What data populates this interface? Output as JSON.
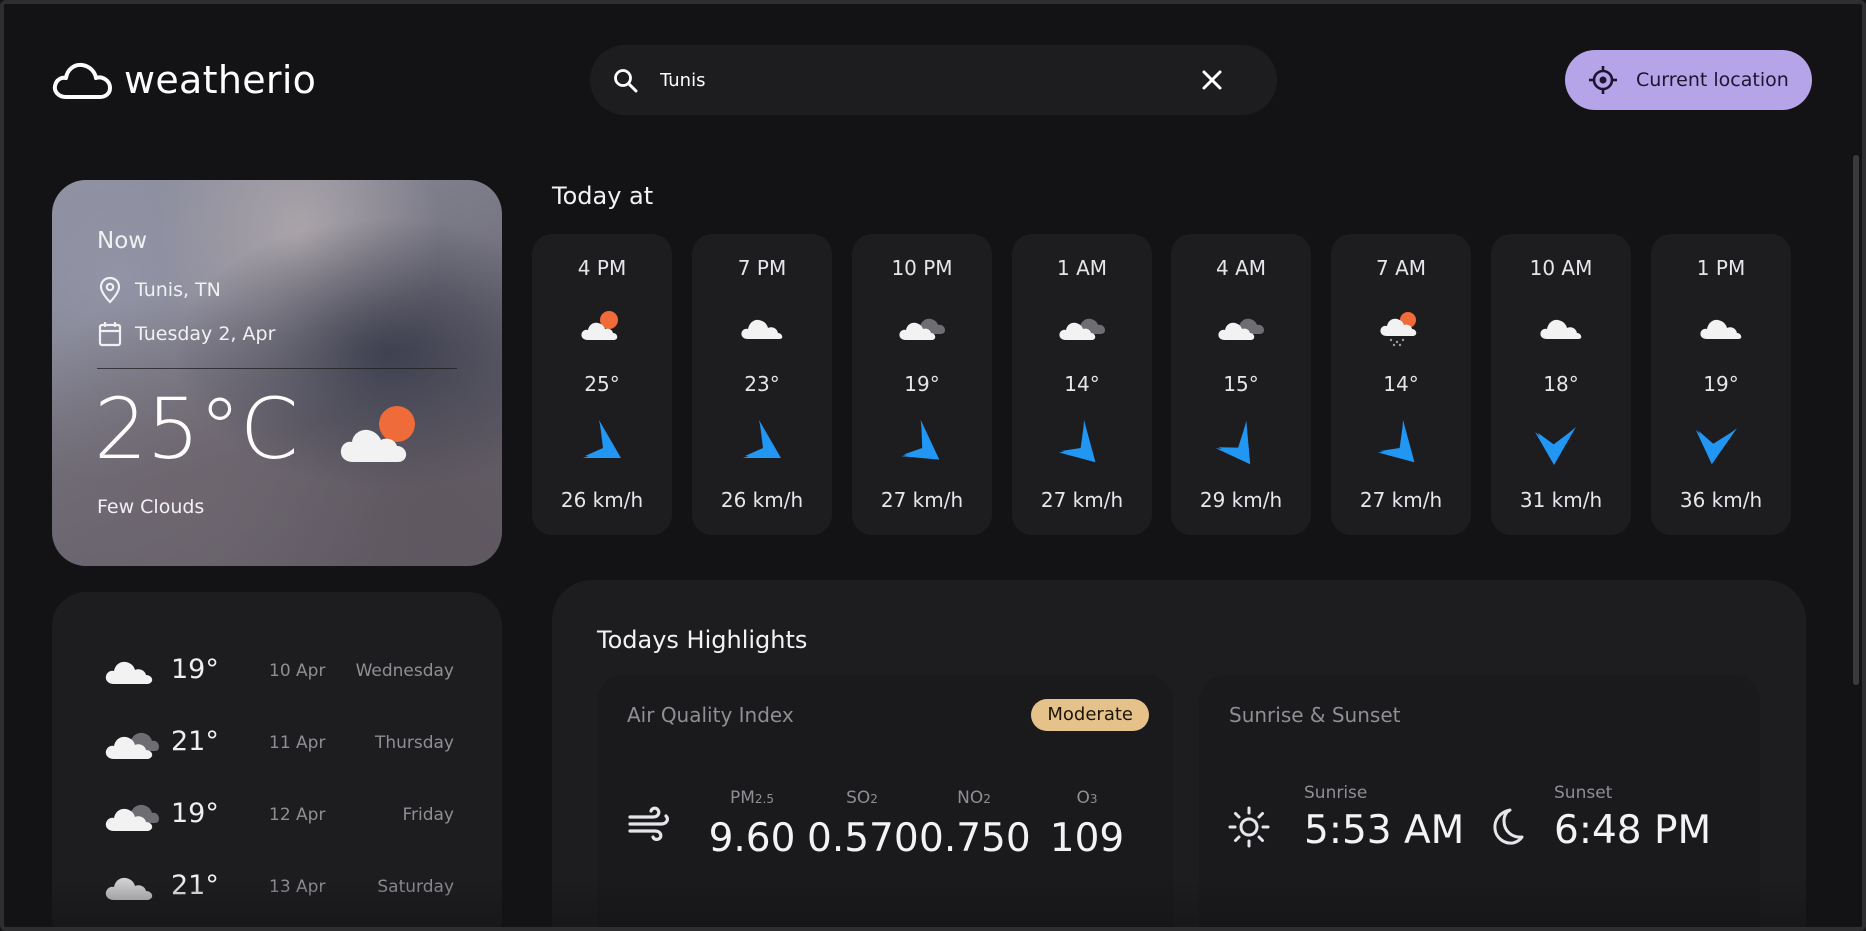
{
  "app": {
    "name": "weatherio"
  },
  "search": {
    "value": "Tunis",
    "placeholder": ""
  },
  "location_button": {
    "label": "Current location"
  },
  "now": {
    "label": "Now",
    "location": "Tunis, TN",
    "date": "Tuesday 2, Apr",
    "temp": "25°C",
    "description": "Few Clouds",
    "icon": "few-clouds-day-icon"
  },
  "forecast": [
    {
      "temp": "19°",
      "date": "10 Apr",
      "day": "Wednesday",
      "icon": "cloud-icon"
    },
    {
      "temp": "21°",
      "date": "11 Apr",
      "day": "Thursday",
      "icon": "broken-clouds-icon"
    },
    {
      "temp": "19°",
      "date": "12 Apr",
      "day": "Friday",
      "icon": "broken-clouds-icon"
    },
    {
      "temp": "21°",
      "date": "13 Apr",
      "day": "Saturday",
      "icon": "cloud-icon"
    }
  ],
  "today": {
    "title": "Today at",
    "hours": [
      {
        "time": "4 PM",
        "temp": "25°",
        "wind": "26 km/h",
        "icon": "few-clouds-day-icon",
        "wind_deg": 135
      },
      {
        "time": "7 PM",
        "temp": "23°",
        "wind": "26 km/h",
        "icon": "cloud-icon",
        "wind_deg": 135
      },
      {
        "time": "10 PM",
        "temp": "19°",
        "wind": "27 km/h",
        "icon": "broken-clouds-icon",
        "wind_deg": 140
      },
      {
        "time": "1 AM",
        "temp": "14°",
        "wind": "27 km/h",
        "icon": "broken-clouds-icon",
        "wind_deg": 150
      },
      {
        "time": "4 AM",
        "temp": "15°",
        "wind": "29 km/h",
        "icon": "broken-clouds-icon",
        "wind_deg": 160
      },
      {
        "time": "7 AM",
        "temp": "14°",
        "wind": "27 km/h",
        "icon": "rain-sun-icon",
        "wind_deg": 150
      },
      {
        "time": "10 AM",
        "temp": "18°",
        "wind": "31 km/h",
        "icon": "cloud-icon",
        "wind_deg": 195
      },
      {
        "time": "1 PM",
        "temp": "19°",
        "wind": "36 km/h",
        "icon": "cloud-icon",
        "wind_deg": 200
      }
    ]
  },
  "highlights": {
    "title": "Todays Highlights",
    "air_quality": {
      "title": "Air Quality Index",
      "badge": "Moderate",
      "items": [
        {
          "label": "PM",
          "sub": "2.5",
          "value": "9.60"
        },
        {
          "label": "SO",
          "sub": "2",
          "value": "0.570"
        },
        {
          "label": "NO",
          "sub": "2",
          "value": "0.750"
        },
        {
          "label": "O",
          "sub": "3",
          "value": "109"
        }
      ]
    },
    "sun": {
      "title": "Sunrise & Sunset",
      "sunrise_label": "Sunrise",
      "sunrise": "5:53 AM",
      "sunset_label": "Sunset",
      "sunset": "6:48 PM"
    }
  },
  "colors": {
    "background": "#131315",
    "card": "#1d1d20",
    "accent": "#b6a4e8",
    "badge": "#e5c28a",
    "wind_arrow": "#2196f3",
    "sun": "#ef6b3a"
  }
}
